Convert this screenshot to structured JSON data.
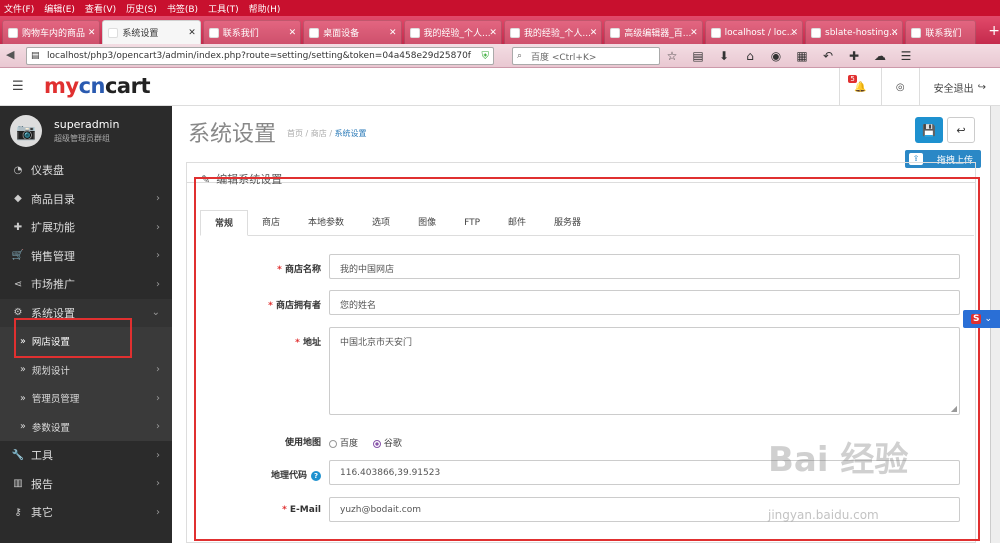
{
  "browser": {
    "menus": [
      "文件(F)",
      "编辑(E)",
      "查看(V)",
      "历史(S)",
      "书签(B)",
      "工具(T)",
      "帮助(H)"
    ],
    "tabs": [
      "购物车内的商品",
      "系统设置",
      "联系我们",
      "桌面设备",
      "我的经验_个人...",
      "我的经验_个人...",
      "高级编辑器_百...",
      "localhost / loc...",
      "sblate-hosting...",
      "联系我们"
    ],
    "active_tab": 1,
    "url": "localhost/php3/opencart3/admin/index.php?route=setting/setting&token=04a458e29d25870f",
    "search_placeholder": "百度 <Ctrl+K>"
  },
  "header": {
    "logo_a": "my",
    "logo_b": "cn",
    "logo_c": "cart",
    "notify_count": "5",
    "logout": "安全退出"
  },
  "sidebar": {
    "user_name": "superadmin",
    "user_role": "超级管理员群组",
    "items": [
      {
        "label": "仪表盘",
        "icon": "dashboard-icon"
      },
      {
        "label": "商品目录",
        "icon": "tag-icon"
      },
      {
        "label": "扩展功能",
        "icon": "puzzle-icon"
      },
      {
        "label": "销售管理",
        "icon": "cart-icon"
      },
      {
        "label": "市场推广",
        "icon": "share-icon"
      },
      {
        "label": "系统设置",
        "icon": "cog-icon"
      }
    ],
    "sub_items": [
      "网店设置",
      "规划设计",
      "管理员管理",
      "参数设置"
    ],
    "bottom_items": [
      {
        "label": "工具",
        "icon": "wrench-icon"
      },
      {
        "label": "报告",
        "icon": "bar-chart-icon"
      },
      {
        "label": "其它",
        "icon": "key-icon"
      }
    ]
  },
  "page": {
    "title": "系统设置",
    "breadcrumb": [
      "首页",
      "商店",
      "系统设置"
    ],
    "upload_label": "拖拽上传",
    "panel_title": "编辑系统设置",
    "tabs": [
      "常规",
      "商店",
      "本地参数",
      "选项",
      "图像",
      "FTP",
      "邮件",
      "服务器"
    ],
    "fields": {
      "store_name_label": "商店名称",
      "store_name_value": "我的中国网店",
      "owner_label": "商店拥有者",
      "owner_value": "您的姓名",
      "address_label": "地址",
      "address_value": "中国北京市天安门",
      "map_label": "使用地图",
      "map_option_1": "百度",
      "map_option_2": "谷歌",
      "geocode_label": "地理代码",
      "geocode_value": "116.403866,39.91523",
      "email_label": "E-Mail",
      "email_value": "yuzh@bodait.com"
    }
  },
  "watermark": {
    "main": "Bai 经验",
    "url": "jingyan.baidu.com"
  },
  "colors": {
    "accent": "#1e91cf",
    "highlight": "#e03030",
    "sidebar": "#2b2b2b"
  }
}
